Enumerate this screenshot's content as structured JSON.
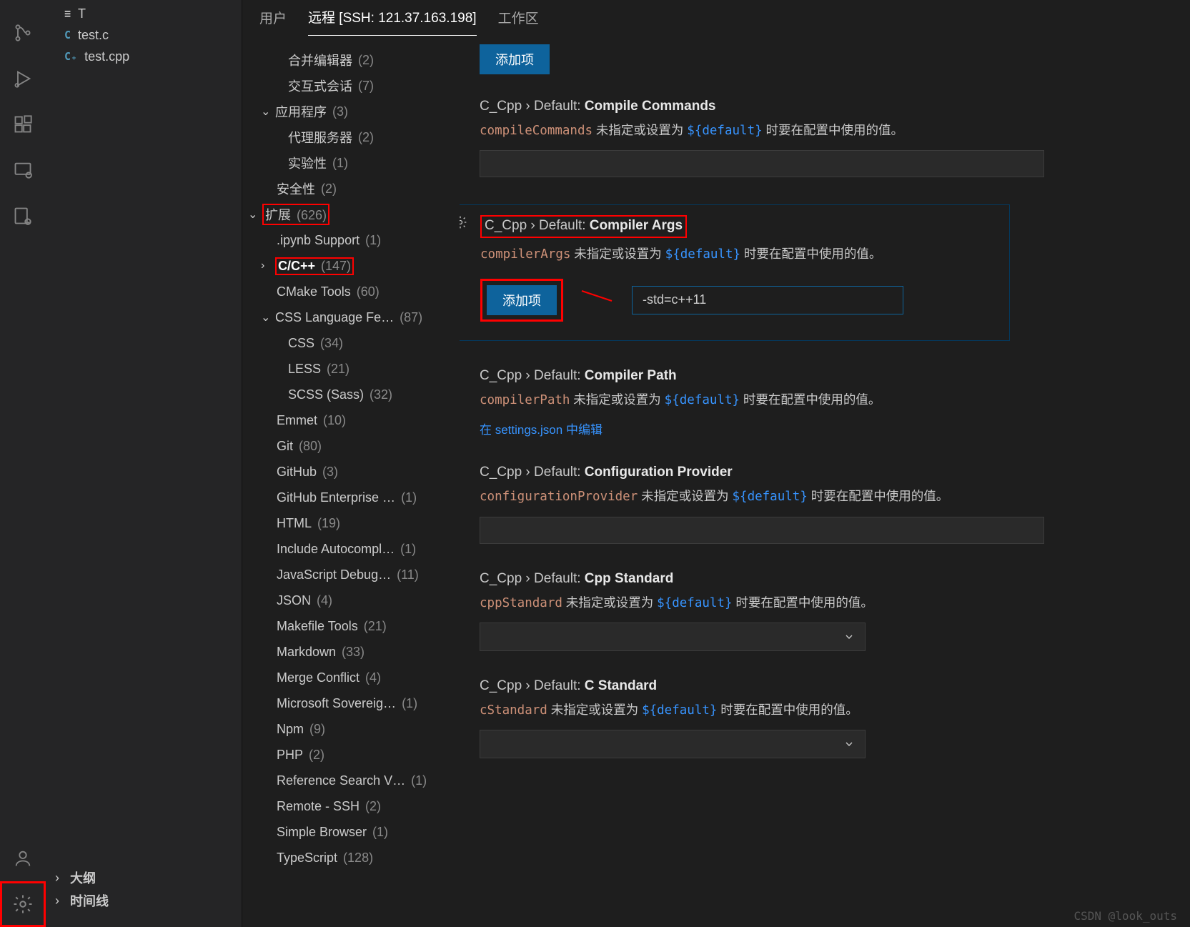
{
  "activity_icons": [
    "source-control",
    "run-debug",
    "extensions",
    "remote-explorer",
    "settings-sync"
  ],
  "explorer": {
    "files": [
      {
        "lang": "≡",
        "langclass": "",
        "name": "T"
      },
      {
        "lang": "C",
        "langclass": "c",
        "name": "test.c"
      },
      {
        "lang": "C₊",
        "langclass": "cpp",
        "name": "test.cpp"
      }
    ],
    "outline_label": "大纲",
    "timeline_label": "时间线"
  },
  "tabs": {
    "user": "用户",
    "remote": "远程 [SSH: 121.37.163.198]",
    "workspace": "工作区"
  },
  "tree": [
    {
      "lev": 2,
      "label": "合并编辑器",
      "count": "(2)"
    },
    {
      "lev": 2,
      "label": "交互式会话",
      "count": "(7)"
    },
    {
      "lev": 1,
      "tw": "⌄",
      "label": "应用程序",
      "count": "(3)"
    },
    {
      "lev": 2,
      "label": "代理服务器",
      "count": "(2)"
    },
    {
      "lev": 2,
      "label": "实验性",
      "count": "(1)"
    },
    {
      "lev": 1,
      "label": "安全性",
      "count": "(2)"
    },
    {
      "lev": 0,
      "tw": "⌄",
      "label": "扩展",
      "count": "(626)",
      "red": true
    },
    {
      "lev": 1,
      "label": ".ipynb Support",
      "count": "(1)"
    },
    {
      "lev": 1,
      "tw": "›",
      "label": "C/C++",
      "count": "(147)",
      "bold": true,
      "red": true
    },
    {
      "lev": 1,
      "label": "CMake Tools",
      "count": "(60)"
    },
    {
      "lev": 1,
      "tw": "⌄",
      "label": "CSS Language Fe…",
      "count": "(87)"
    },
    {
      "lev": 2,
      "label": "CSS",
      "count": "(34)"
    },
    {
      "lev": 2,
      "label": "LESS",
      "count": "(21)"
    },
    {
      "lev": 2,
      "label": "SCSS (Sass)",
      "count": "(32)"
    },
    {
      "lev": 1,
      "label": "Emmet",
      "count": "(10)"
    },
    {
      "lev": 1,
      "label": "Git",
      "count": "(80)"
    },
    {
      "lev": 1,
      "label": "GitHub",
      "count": "(3)"
    },
    {
      "lev": 1,
      "label": "GitHub Enterprise …",
      "count": "(1)"
    },
    {
      "lev": 1,
      "label": "HTML",
      "count": "(19)"
    },
    {
      "lev": 1,
      "label": "Include Autocompl…",
      "count": "(1)"
    },
    {
      "lev": 1,
      "label": "JavaScript Debug…",
      "count": "(11)"
    },
    {
      "lev": 1,
      "label": "JSON",
      "count": "(4)"
    },
    {
      "lev": 1,
      "label": "Makefile Tools",
      "count": "(21)"
    },
    {
      "lev": 1,
      "label": "Markdown",
      "count": "(33)"
    },
    {
      "lev": 1,
      "label": "Merge Conflict",
      "count": "(4)"
    },
    {
      "lev": 1,
      "label": "Microsoft Sovereig…",
      "count": "(1)"
    },
    {
      "lev": 1,
      "label": "Npm",
      "count": "(9)"
    },
    {
      "lev": 1,
      "label": "PHP",
      "count": "(2)"
    },
    {
      "lev": 1,
      "label": "Reference Search V…",
      "count": "(1)"
    },
    {
      "lev": 1,
      "label": "Remote - SSH",
      "count": "(2)"
    },
    {
      "lev": 1,
      "label": "Simple Browser",
      "count": "(1)"
    },
    {
      "lev": 1,
      "label": "TypeScript",
      "count": "(128)"
    }
  ],
  "top_add_label": "添加项",
  "sections": {
    "compileCommands": {
      "path": "C_Cpp › Default:",
      "key": "Compile Commands",
      "code": "compileCommands",
      "mid": " 未指定或设置为 ",
      "tok": "${default}",
      "tail": " 时要在配置中使用的值。"
    },
    "compilerArgs": {
      "path": "C_Cpp › Default:",
      "key": "Compiler Args",
      "code": "compilerArgs",
      "mid": " 未指定或设置为 ",
      "tok": "${default}",
      "tail": " 时要在配置中使用的值。",
      "add_label": "添加项",
      "example": "-std=c++11"
    },
    "compilerPath": {
      "path": "C_Cpp › Default:",
      "key": "Compiler Path",
      "code": "compilerPath",
      "mid": " 未指定或设置为 ",
      "tok": "${default}",
      "tail": " 时要在配置中使用的值。",
      "link": "在 settings.json 中编辑"
    },
    "configurationProvider": {
      "path": "C_Cpp › Default:",
      "key": "Configuration Provider",
      "code": "configurationProvider",
      "mid": " 未指定或设置为 ",
      "tok": "${default}",
      "tail": " 时要在配置中使用的值。"
    },
    "cppStandard": {
      "path": "C_Cpp › Default:",
      "key": "Cpp Standard",
      "code": "cppStandard",
      "mid": " 未指定或设置为 ",
      "tok": "${default}",
      "tail": " 时要在配置中使用的值。"
    },
    "cStandard": {
      "path": "C_Cpp › Default:",
      "key": "C Standard",
      "code": "cStandard",
      "mid": " 未指定或设置为 ",
      "tok": "${default}",
      "tail": " 时要在配置中使用的值。"
    }
  },
  "watermark": "CSDN @look_outs"
}
